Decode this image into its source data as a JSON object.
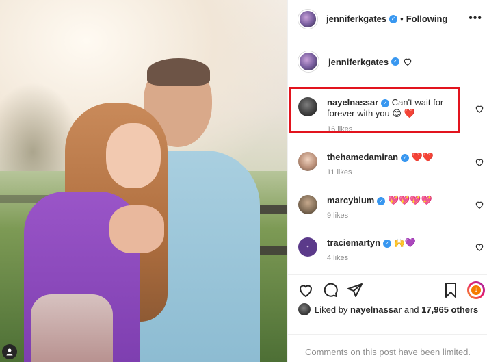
{
  "header": {
    "username": "jenniferkgates",
    "separator": "•",
    "follow_status": "Following",
    "more_icon": "more-horizontal-icon"
  },
  "caption": {
    "username": "jenniferkgates"
  },
  "comments": [
    {
      "username": "nayelnassar",
      "text": "Can't wait for forever with you 😊",
      "emoji_tail": "❤️",
      "likes": "16 likes"
    },
    {
      "username": "thehamedamiran",
      "text": "❤️❤️",
      "likes": "11 likes"
    },
    {
      "username": "marcyblum",
      "text": "💖💖💖💖",
      "likes": "9 likes"
    },
    {
      "username": "traciemartyn",
      "text": "🙌💜",
      "likes": "4 likes"
    }
  ],
  "actions": {
    "like": "heart-icon",
    "comment": "comment-icon",
    "share": "share-icon",
    "save": "bookmark-icon"
  },
  "liked_by": {
    "prefix": "Liked by",
    "user": "nayelnassar",
    "and": "and",
    "others": "17,965 others"
  },
  "footer": {
    "limited_text": "Comments on this post have been limited."
  },
  "colors": {
    "verified": "#3897f0",
    "highlight": "#e2141e",
    "heart_red": "#ed4956",
    "muted": "#8e8e8e"
  }
}
